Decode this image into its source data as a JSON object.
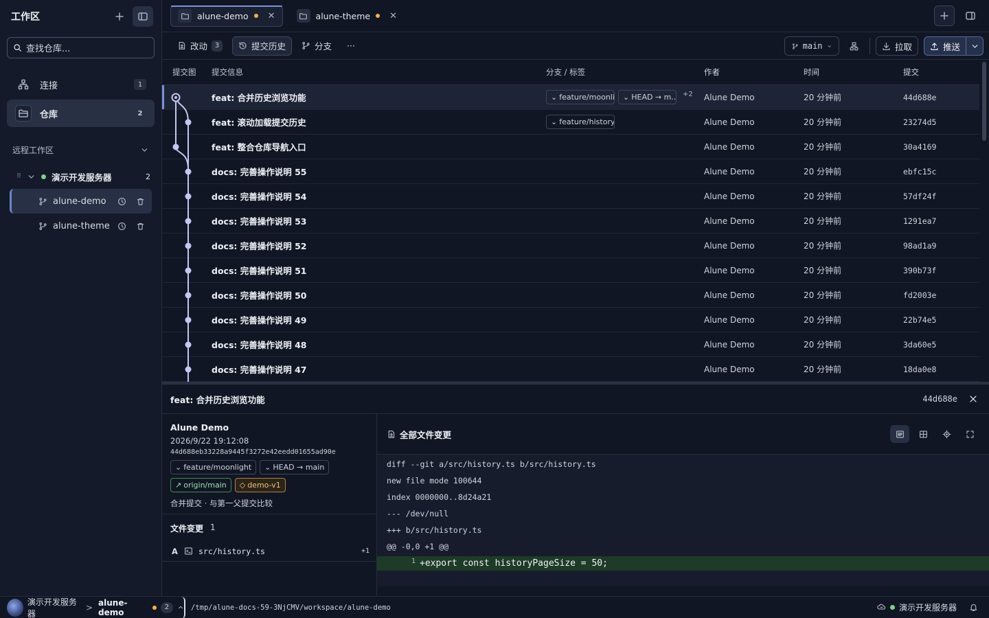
{
  "sidebar": {
    "title": "工作区",
    "search_placeholder": "查找仓库...",
    "nav": [
      {
        "label": "连接",
        "count": "1"
      },
      {
        "label": "仓库",
        "count": "2"
      }
    ],
    "remote_section": "远程工作区",
    "server": {
      "name": "演示开发服务器",
      "count": "2"
    },
    "repos": [
      "alune-demo",
      "alune-theme"
    ]
  },
  "tabs": [
    {
      "label": "alune-demo"
    },
    {
      "label": "alune-theme"
    }
  ],
  "toolbar": {
    "changes": "改动",
    "changes_count": "3",
    "history": "提交历史",
    "branches": "分支",
    "more": "···",
    "branch": "main",
    "pull": "拉取",
    "push": "推送"
  },
  "table": {
    "headers": {
      "graph": "提交图",
      "message": "提交信息",
      "refs": "分支 / 标签",
      "author": "作者",
      "time": "时间",
      "commit": "提交"
    },
    "rows": [
      {
        "message": "feat: 合并历史浏览功能",
        "refs": [
          "feature/moonli...",
          "HEAD → m..."
        ],
        "more": "+2",
        "author": "Alune Demo",
        "time": "20 分钟前",
        "hash": "44d688e"
      },
      {
        "message": "feat: 滚动加载提交历史",
        "refs": [
          "feature/history"
        ],
        "more": "",
        "author": "Alune Demo",
        "time": "20 分钟前",
        "hash": "23274d5"
      },
      {
        "message": "feat: 整合仓库导航入口",
        "refs": [],
        "more": "",
        "author": "Alune Demo",
        "time": "20 分钟前",
        "hash": "30a4169"
      },
      {
        "message": "docs: 完善操作说明 55",
        "refs": [],
        "more": "",
        "author": "Alune Demo",
        "time": "20 分钟前",
        "hash": "ebfc15c"
      },
      {
        "message": "docs: 完善操作说明 54",
        "refs": [],
        "more": "",
        "author": "Alune Demo",
        "time": "20 分钟前",
        "hash": "57df24f"
      },
      {
        "message": "docs: 完善操作说明 53",
        "refs": [],
        "more": "",
        "author": "Alune Demo",
        "time": "20 分钟前",
        "hash": "1291ea7"
      },
      {
        "message": "docs: 完善操作说明 52",
        "refs": [],
        "more": "",
        "author": "Alune Demo",
        "time": "20 分钟前",
        "hash": "98ad1a9"
      },
      {
        "message": "docs: 完善操作说明 51",
        "refs": [],
        "more": "",
        "author": "Alune Demo",
        "time": "20 分钟前",
        "hash": "390b73f"
      },
      {
        "message": "docs: 完善操作说明 50",
        "refs": [],
        "more": "",
        "author": "Alune Demo",
        "time": "20 分钟前",
        "hash": "fd2003e"
      },
      {
        "message": "docs: 完善操作说明 49",
        "refs": [],
        "more": "",
        "author": "Alune Demo",
        "time": "20 分钟前",
        "hash": "22b74e5"
      },
      {
        "message": "docs: 完善操作说明 48",
        "refs": [],
        "more": "",
        "author": "Alune Demo",
        "time": "20 分钟前",
        "hash": "3da60e5"
      },
      {
        "message": "docs: 完善操作说明 47",
        "refs": [],
        "more": "",
        "author": "Alune Demo",
        "time": "20 分钟前",
        "hash": "18da0e8"
      }
    ]
  },
  "detail": {
    "title": "feat: 合并历史浏览功能",
    "hash": "44d688e",
    "author": "Alune Demo",
    "date": "2026/9/22 19:12:08",
    "sha": "44d688eb33228a9445f3272e42eedd01655ad90e",
    "refs": [
      "feature/moonlight",
      "HEAD → main",
      "origin/main"
    ],
    "tag": "demo-v1",
    "note": "合并提交 · 与第一父提交比较",
    "files_title": "文件变更",
    "files_count": "1",
    "file": {
      "status": "A",
      "name": "src/history.ts",
      "count": "+1"
    },
    "all_changes": "全部文件变更",
    "diff": [
      "diff --git a/src/history.ts b/src/history.ts",
      "new file mode 100644",
      "index 0000000..8d24a21",
      "--- /dev/null",
      "+++ b/src/history.ts",
      "@@ -0,0 +1 @@"
    ],
    "add_line_no": "1",
    "add_line": "+export const historyPageSize = 50;"
  },
  "status": {
    "server": "演示开发服务器",
    "sep": ">",
    "repo": "alune-demo",
    "count": "2",
    "path": "/tmp/alune-docs-59-3NjCMV/workspace/alune-demo",
    "right_server": "演示开发服务器"
  },
  "colors": {
    "accent": "#7a93d8",
    "graph": "#c7c6f2",
    "modified": "#f1b24a",
    "online": "#7fd18a"
  }
}
